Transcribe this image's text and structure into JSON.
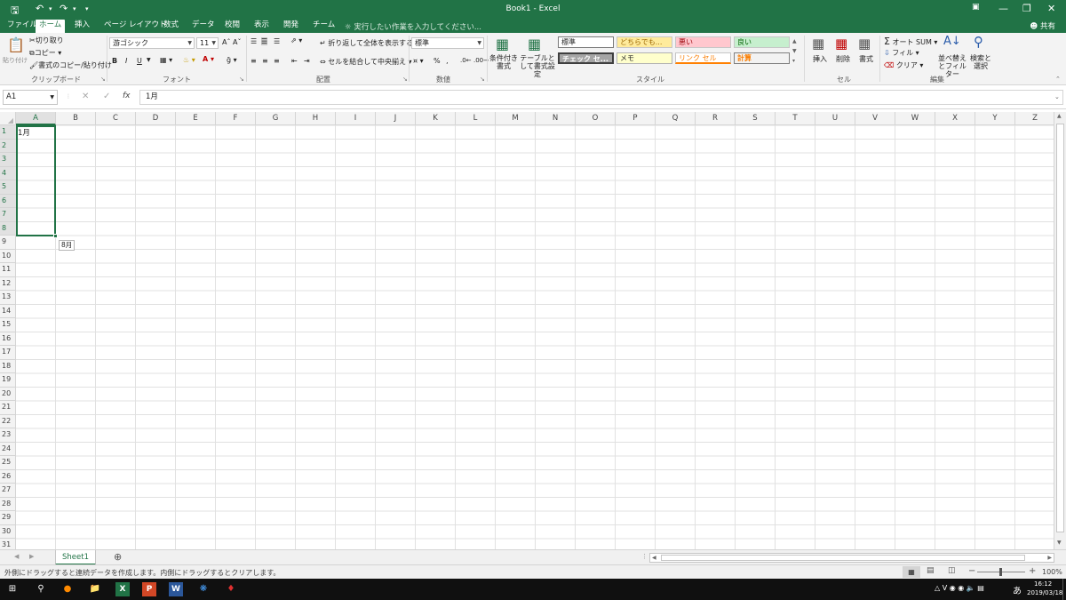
{
  "window": {
    "title": "Book1 - Excel"
  },
  "tabs": [
    {
      "label": "ファイル"
    },
    {
      "label": "ホーム"
    },
    {
      "label": "挿入"
    },
    {
      "label": "ページ レイアウト"
    },
    {
      "label": "数式"
    },
    {
      "label": "データ"
    },
    {
      "label": "校閲"
    },
    {
      "label": "表示"
    },
    {
      "label": "開発"
    },
    {
      "label": "チーム"
    }
  ],
  "tell_me": "実行したい作業を入力してください...",
  "share": "共有",
  "ribbon": {
    "clipboard": {
      "paste": "貼り付け",
      "cut": "切り取り",
      "copy": "コピー",
      "format_painter": "書式のコピー/貼り付け",
      "label": "クリップボード"
    },
    "font": {
      "name": "游ゴシック",
      "size": "11",
      "bold": "B",
      "italic": "I",
      "underline": "U",
      "label": "フォント"
    },
    "alignment": {
      "wrap": "折り返して全体を表示する",
      "merge": "セルを結合して中央揃え",
      "label": "配置"
    },
    "number": {
      "format": "標準",
      "percent": "%",
      "label": "数値"
    },
    "styles": {
      "conditional": "条件付き書式",
      "table": "テーブルとして書式設定",
      "cells": [
        "標準",
        "どちらでも...",
        "悪い",
        "良い",
        "チェック セ...",
        "メモ",
        "リンク セル",
        "計算"
      ],
      "label": "スタイル"
    },
    "cells_group": {
      "insert": "挿入",
      "delete": "削除",
      "format": "書式",
      "label": "セル"
    },
    "editing": {
      "autosum": "オート SUM",
      "fill": "フィル",
      "clear": "クリア",
      "sort": "並べ替えとフィルター",
      "find": "検索と選択",
      "label": "編集"
    }
  },
  "formula_bar": {
    "name_box": "A1",
    "fx": "fx",
    "content": "1月"
  },
  "grid": {
    "columns": [
      "A",
      "B",
      "C",
      "D",
      "E",
      "F",
      "G",
      "H",
      "I",
      "J",
      "K",
      "L",
      "M",
      "N",
      "O",
      "P",
      "Q",
      "R",
      "S",
      "T",
      "U",
      "V",
      "W",
      "X",
      "Y",
      "Z"
    ],
    "rows": [
      "1",
      "2",
      "3",
      "4",
      "5",
      "6",
      "7",
      "8",
      "9",
      "10",
      "11",
      "12",
      "13",
      "14",
      "15",
      "16",
      "17",
      "18",
      "19",
      "20",
      "21",
      "22",
      "23",
      "24",
      "25",
      "26",
      "27",
      "28",
      "29",
      "30",
      "31"
    ],
    "a1_value": "1月",
    "fill_tooltip": "8月"
  },
  "sheets": [
    {
      "name": "Sheet1"
    }
  ],
  "status": {
    "message": "外側にドラッグすると連続データを作成します。内側にドラッグするとクリアします。",
    "zoom": "100%"
  },
  "taskbar": {
    "time": "16:12",
    "date": "2019/03/18",
    "ime": "あ"
  }
}
